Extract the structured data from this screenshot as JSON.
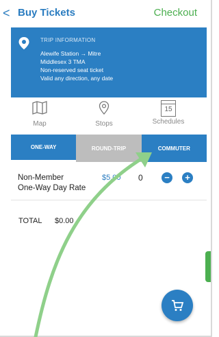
{
  "header": {
    "back_symbol": "<",
    "title": "Buy Tickets",
    "checkout_label": "Checkout"
  },
  "trip": {
    "heading": "TRIP INFORMATION",
    "route": "Alewife Station  →  Mitre",
    "zone": "Middlesex 3 TMA",
    "ticket_type": "Non-reserved seat ticket",
    "validity": "Valid any direction, any date"
  },
  "nav": {
    "map_label": "Map",
    "stops_label": "Stops",
    "schedules_label": "Schedules",
    "schedule_day": "15"
  },
  "tabs": {
    "one_way": "ONE-WAY",
    "round_trip": "ROUND-TRIP",
    "commuter": "COMMUTER"
  },
  "fare_row": {
    "name_line1": "Non-Member",
    "name_line2": "One-Way Day Rate",
    "price": "$5.00",
    "quantity": "0"
  },
  "total": {
    "label": "TOTAL",
    "value": "$0.00"
  },
  "colors": {
    "accent_blue": "#2b7fc3",
    "checkout_green": "#4caf50",
    "tab_inactive_gray": "#bdbdbd",
    "annotation_arrow": "#8fd08a"
  },
  "icons": {
    "back": "chevron-left-icon",
    "location": "location-pin-icon",
    "map": "map-icon",
    "stops": "stop-marker-icon",
    "schedules": "calendar-icon",
    "cart": "shopping-cart-icon"
  }
}
